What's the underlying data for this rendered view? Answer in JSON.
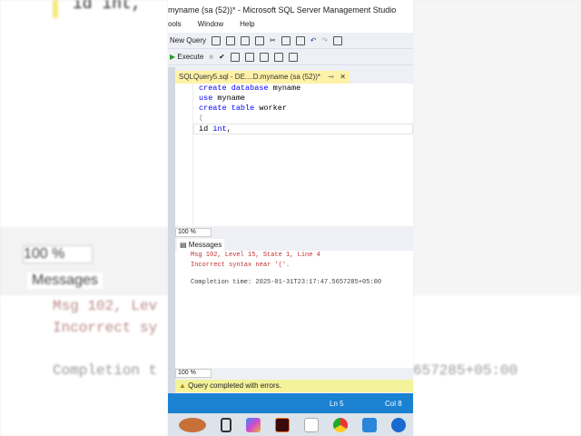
{
  "window": {
    "title": "myname (sa (52))* - Microsoft SQL Server Management Studio"
  },
  "menu": [
    "ools",
    "Window",
    "Help"
  ],
  "toolbar": {
    "new_query": "New Query",
    "execute": "Execute"
  },
  "tab": {
    "label": "SQLQuery5.sql - DE....D.myname (sa (52))*"
  },
  "editor": {
    "lines": [
      "create database myname",
      "use myname",
      "create table worker",
      "(",
      "id int,"
    ]
  },
  "zoom": {
    "top": "100 %",
    "bottom": "100 %"
  },
  "messages": {
    "tab": "Messages",
    "line1": "Msg 102, Level 15, State 1, Line 4",
    "line2": "Incorrect syntax near '('.",
    "line3": "Completion time: 2025-01-31T23:17:47.5657285+05:00"
  },
  "status": {
    "text": "Query completed with errors.",
    "ln": "Ln 5",
    "col": "Col 8"
  },
  "background": {
    "code": "id int,",
    "zoom": "100 %",
    "messages": "Messages",
    "msg1": "Msg 102, Lev",
    "msg2": "Incorrect sy",
    "msg3": "Completion t",
    "msg3_right": "657285+05:00"
  }
}
